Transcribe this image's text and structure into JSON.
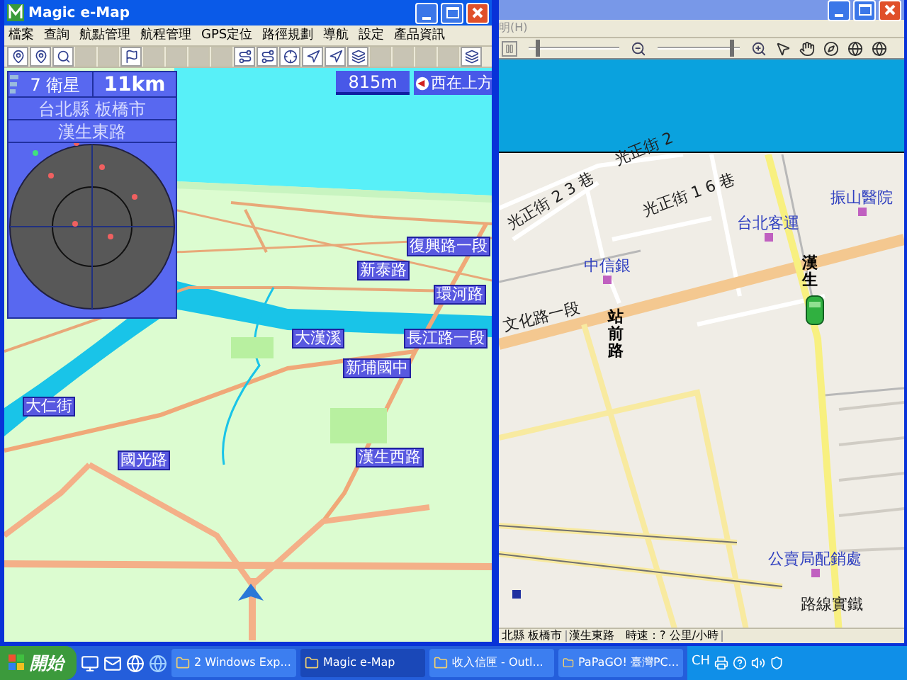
{
  "left_window": {
    "title": "Magic e-Map",
    "menu": [
      "檔案",
      "查詢",
      "航點管理",
      "航程管理",
      "GPS定位",
      "路徑規劃",
      "導航",
      "設定",
      "產品資訊"
    ],
    "toolbar": [
      {
        "disabled": false
      },
      {
        "disabled": false
      },
      {
        "disabled": false
      },
      {
        "disabled": true
      },
      {
        "disabled": true
      },
      {
        "disabled": false
      },
      {
        "disabled": true
      },
      {
        "disabled": true
      },
      {
        "disabled": true
      },
      {
        "disabled": true
      },
      {
        "disabled": false
      },
      {
        "disabled": false
      },
      {
        "disabled": false
      },
      {
        "disabled": false
      },
      {
        "disabled": false
      },
      {
        "disabled": false
      },
      {
        "disabled": true
      },
      {
        "disabled": true
      },
      {
        "disabled": true
      },
      {
        "disabled": true
      },
      {
        "disabled": false
      }
    ],
    "info_panel": {
      "satellites": "7 衛星",
      "distance": "11km",
      "city": "台北縣 板橋市",
      "road": "漢生東路"
    },
    "scale": "815m",
    "orientation": "西在上方",
    "map_labels": [
      "復興路一段",
      "新泰路",
      "環河路",
      "大漢溪",
      "長江路一段",
      "新埔國中",
      "大仁街",
      "國光路",
      "漢生西路"
    ]
  },
  "right_window": {
    "menu": [
      "明(H)"
    ],
    "sliders": [
      {
        "level": 0.08
      },
      {
        "level": 0.92
      }
    ],
    "map_labels": [
      {
        "text": "光正街 2",
        "kind": "street"
      },
      {
        "text": "振山醫院",
        "kind": "poi"
      },
      {
        "text": "光正街 2 3 巷",
        "kind": "street"
      },
      {
        "text": "光正街 1 6 巷",
        "kind": "street"
      },
      {
        "text": "台北客運",
        "kind": "poi"
      },
      {
        "text": "漢生",
        "kind": "vertical"
      },
      {
        "text": "中信銀",
        "kind": "poi"
      },
      {
        "text": "站前路",
        "kind": "vertical"
      },
      {
        "text": "文化路一段",
        "kind": "street"
      },
      {
        "text": "公賣局配銷處",
        "kind": "poi"
      },
      {
        "text": "路線實鐵",
        "kind": "street"
      }
    ],
    "status_bar": [
      "北縣 板橋市",
      "漢生東路　時速：? 公里/小時"
    ]
  },
  "taskbar": {
    "start": "開始",
    "tasks": [
      {
        "label": "2 Windows Exp...",
        "selected": false
      },
      {
        "label": "Magic e-Map",
        "selected": true
      },
      {
        "label": "收入信匣 - Outl...",
        "selected": false
      },
      {
        "label": "PaPaGO! 臺灣PC...",
        "selected": false
      }
    ],
    "language": "CH"
  }
}
